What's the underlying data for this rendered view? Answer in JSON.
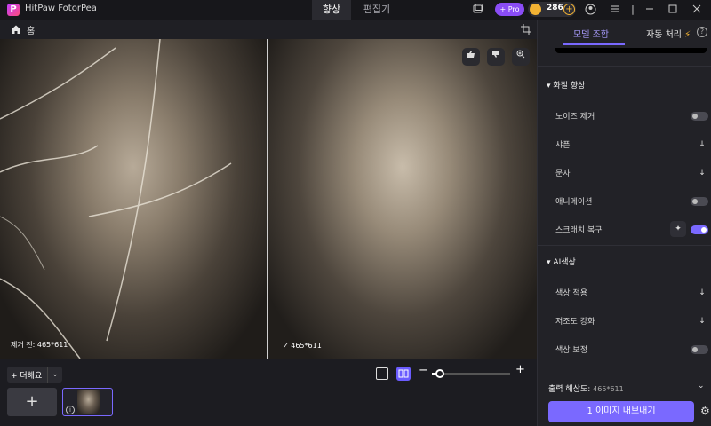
{
  "app": {
    "title": "HitPaw FotorPea"
  },
  "tabs": [
    {
      "label": "향상"
    },
    {
      "label": "편집기"
    }
  ],
  "account": {
    "pro_label": "+ Pro",
    "coins": "286"
  },
  "toolbar": {
    "home_label": "홈"
  },
  "canvas": {
    "before_label": "제거 전: 465*611",
    "after_label": "465*611"
  },
  "bottom": {
    "add_label": "+ 더해요"
  },
  "panel": {
    "tabs": [
      {
        "label": "모델 조합"
      },
      {
        "label": "자동 처리"
      }
    ],
    "sections": [
      {
        "title": "화질 향상",
        "items": [
          {
            "label": "노이즈 제거",
            "control": "toggle",
            "on": false
          },
          {
            "label": "샤픈",
            "control": "download"
          },
          {
            "label": "문자",
            "control": "download"
          },
          {
            "label": "애니메이션",
            "control": "toggle",
            "on": false
          },
          {
            "label": "스크래치 복구",
            "control": "toggle",
            "on": true
          }
        ]
      },
      {
        "title": "AI색상",
        "items": [
          {
            "label": "색상 적용",
            "control": "download"
          },
          {
            "label": "저조도 강화",
            "control": "download"
          },
          {
            "label": "색상 보정",
            "control": "toggle",
            "on": false
          }
        ]
      }
    ],
    "resolution_label": "출력 해상도:",
    "resolution_value": "465*611",
    "export_label": "1 이미지 내보내기"
  },
  "zoom": {
    "fraction": 0.1
  },
  "colors": {
    "accent": "#7a69ff",
    "pro": "#8a4cf5",
    "coin": "#f2b233"
  }
}
